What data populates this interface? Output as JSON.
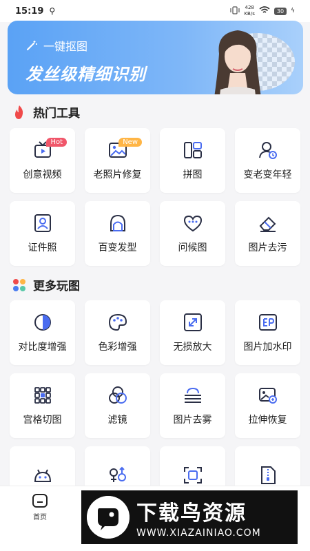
{
  "status_bar": {
    "time": "15:19",
    "net_speed_value": "428",
    "net_speed_unit": "KB/s",
    "battery": "30"
  },
  "banner": {
    "tag": "一键抠图",
    "headline": "发丝级精细识别"
  },
  "sections": {
    "hot": {
      "title": "热门工具",
      "icon_color": "#f04a4a"
    },
    "more": {
      "title": "更多玩图",
      "icon_colors": [
        "#f04a4a",
        "#ffb545",
        "#4a7cf0",
        "#5ac8a8"
      ]
    }
  },
  "hot_tools": [
    {
      "label": "创意视频",
      "icon": "video-icon",
      "badge": "Hot"
    },
    {
      "label": "老照片修复",
      "icon": "photo-icon",
      "badge": "New"
    },
    {
      "label": "拼图",
      "icon": "collage-icon",
      "badge": ""
    },
    {
      "label": "变老变年轻",
      "icon": "age-icon",
      "badge": ""
    },
    {
      "label": "证件照",
      "icon": "id-photo-icon",
      "badge": ""
    },
    {
      "label": "百变发型",
      "icon": "hairstyle-icon",
      "badge": ""
    },
    {
      "label": "问候图",
      "icon": "greeting-icon",
      "badge": ""
    },
    {
      "label": "图片去污",
      "icon": "eraser-icon",
      "badge": ""
    }
  ],
  "more_tools": [
    {
      "label": "对比度增强",
      "icon": "contrast-icon"
    },
    {
      "label": "色彩增强",
      "icon": "palette-icon"
    },
    {
      "label": "无损放大",
      "icon": "enlarge-icon"
    },
    {
      "label": "图片加水印",
      "icon": "watermark-icon"
    },
    {
      "label": "宫格切图",
      "icon": "grid-cut-icon"
    },
    {
      "label": "滤镜",
      "icon": "filter-icon"
    },
    {
      "label": "图片去雾",
      "icon": "dehaze-icon"
    },
    {
      "label": "拉伸恢复",
      "icon": "stretch-icon"
    },
    {
      "label": "",
      "icon": "android-icon"
    },
    {
      "label": "",
      "icon": "gender-icon"
    },
    {
      "label": "",
      "icon": "scan-icon"
    },
    {
      "label": "",
      "icon": "zip-file-icon"
    }
  ],
  "nav": {
    "home": "首页"
  },
  "watermark": {
    "title": "下载鸟资源",
    "url": "WWW.XIAZAINIAO.COM"
  },
  "colors": {
    "accent": "#4a6cf0",
    "stroke": "#2a2f45"
  }
}
